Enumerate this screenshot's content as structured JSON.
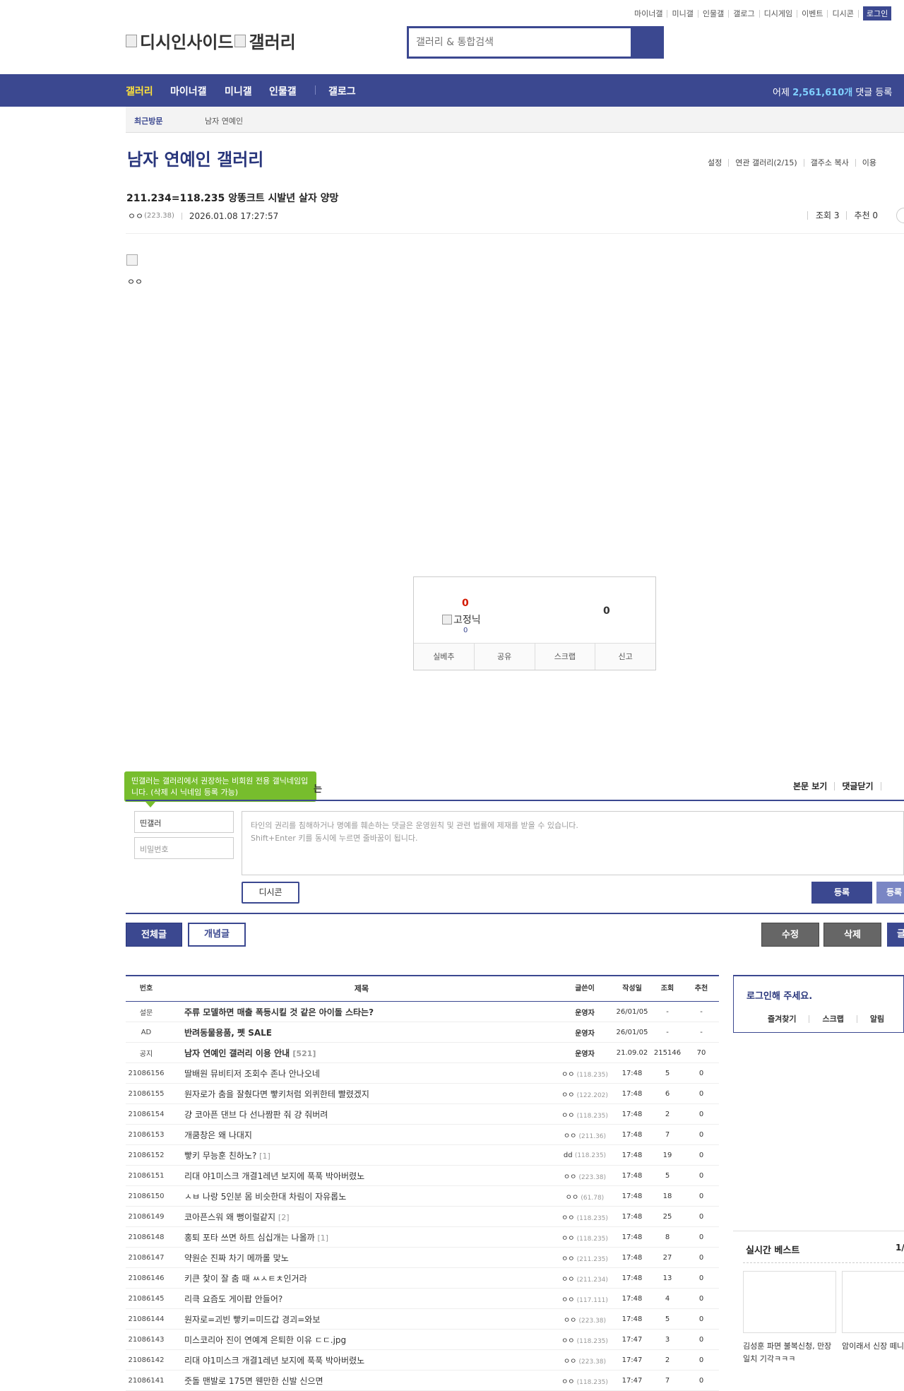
{
  "top_util": [
    "마이너갤",
    "미니갤",
    "인물갤",
    "갤로그",
    "디시게임",
    "이벤트",
    "디시콘"
  ],
  "login_btn": "로그인",
  "logo": {
    "left": "디시인사이드",
    "right": "갤러리"
  },
  "search": {
    "placeholder": "갤러리 & 통합검색"
  },
  "gnb": {
    "items": [
      "갤러리",
      "마이너갤",
      "미니갤",
      "인물갤",
      "갤로그"
    ],
    "stat_prefix": "어제 ",
    "stat_value": "2,561,610개",
    "stat_suffix": " 댓글 등록"
  },
  "visit": {
    "label": "최근방문",
    "gallery": "남자 연예인"
  },
  "gallery": {
    "title": "남자 연예인 갤러리",
    "menu": [
      "설정",
      "연관 갤러리(2/15)",
      "갤주소 복사",
      "이용"
    ]
  },
  "post": {
    "title": "211.234=118.235 앙똥크트 시발년 살자 양망",
    "writer": "ㅇㅇ",
    "ip": "(223.38)",
    "date": "2026.01.08 17:27:57",
    "views": "조회 3",
    "recommends": "추천 0",
    "body": "ㅇㅇ"
  },
  "recommend": {
    "up": "0",
    "fixnick": "고정닉",
    "fixnick_count": "0",
    "down": "0",
    "buttons": [
      "실베추",
      "공유",
      "스크랩",
      "신고"
    ]
  },
  "comment": {
    "tip": "띤갤러는 갤러리에서 권장하는 비회원 전용 갤닉네임입니다. (삭제 시 닉네임 등록 가능)",
    "tip_tail": "는",
    "right": [
      "본문 보기",
      "댓글닫기"
    ],
    "nick": "띤갤러",
    "pw": "비밀번호",
    "notice1": "타인의 권리를 침해하거나 명예를 훼손하는 댓글은 운영원칙 및 관련 법률에 제재를 받을 수 있습니다.",
    "notice2": "Shift+Enter 키를 동시에 누르면 줄바꿈이 됩니다.",
    "dccon": "디시콘",
    "register": "등록",
    "register2": "등록"
  },
  "buttons": {
    "all": "전체글",
    "concept": "개념글",
    "edit": "수정",
    "delete": "삭제",
    "write": "글"
  },
  "list": {
    "headers": [
      "번호",
      "제목",
      "글쓴이",
      "작성일",
      "조회",
      "추천"
    ],
    "rows": [
      {
        "no": "설문",
        "title": "주류 모델하면 매출 폭등시킬 것 같은 아이돌 스타는?",
        "reply": "",
        "writer": "운영자",
        "ip": "",
        "date": "26/01/05",
        "views": "-",
        "rec": "-",
        "bold": true
      },
      {
        "no": "AD",
        "title": "반려동물용품, 펫 SALE",
        "reply": "",
        "writer": "운영자",
        "ip": "",
        "date": "26/01/05",
        "views": "-",
        "rec": "-",
        "bold": true
      },
      {
        "no": "공지",
        "title": "남자 연예인 갤러리 이용 안내",
        "reply": "[521]",
        "writer": "운영자",
        "ip": "",
        "date": "21.09.02",
        "views": "215146",
        "rec": "70",
        "bold": true
      },
      {
        "no": "21086156",
        "title": "딸배원 뮤비티저 조회수 존나 안나오네",
        "reply": "",
        "writer": "ㅇㅇ",
        "ip": "(118.235)",
        "date": "17:48",
        "views": "5",
        "rec": "0",
        "bold": false
      },
      {
        "no": "21086155",
        "title": "원자로가 춤을 잘췄다면 빻키처럼 외퀴한테 빨렸겠지",
        "reply": "",
        "writer": "ㅇㅇ",
        "ip": "(122.202)",
        "date": "17:48",
        "views": "6",
        "rec": "0",
        "bold": false
      },
      {
        "no": "21086154",
        "title": "걍 코아픈 댄브 다 선나짬판 줘 걍 줘버려",
        "reply": "",
        "writer": "ㅇㅇ",
        "ip": "(118.235)",
        "date": "17:48",
        "views": "2",
        "rec": "0",
        "bold": false
      },
      {
        "no": "21086153",
        "title": "개쿰창은 왜 나대지",
        "reply": "",
        "writer": "ㅇㅇ",
        "ip": "(211.36)",
        "date": "17:48",
        "views": "7",
        "rec": "0",
        "bold": false
      },
      {
        "no": "21086152",
        "title": "빻키 무능훈 친하노?",
        "reply": "[1]",
        "writer": "dd",
        "ip": "(118.235)",
        "date": "17:48",
        "views": "19",
        "rec": "0",
        "bold": false
      },
      {
        "no": "21086151",
        "title": "리대 야1미스크 개결1레년 보지에 푹푹 박아버렸노",
        "reply": "",
        "writer": "ㅇㅇ",
        "ip": "(223.38)",
        "date": "17:48",
        "views": "5",
        "rec": "0",
        "bold": false
      },
      {
        "no": "21086150",
        "title": "ㅅㅂ 나랑 5인분 몸 비슷한대 차림이 자유롭노",
        "reply": "",
        "writer": "ㅇㅇ",
        "ip": "(61.78)",
        "date": "17:48",
        "views": "18",
        "rec": "0",
        "bold": false
      },
      {
        "no": "21086149",
        "title": "코아픈스워 왜 뻥이럴같지",
        "reply": "[2]",
        "writer": "ㅇㅇ",
        "ip": "(118.235)",
        "date": "17:48",
        "views": "25",
        "rec": "0",
        "bold": false
      },
      {
        "no": "21086148",
        "title": "홍퇴 포타 쓰면 하트 심십개는 나올까",
        "reply": "[1]",
        "writer": "ㅇㅇ",
        "ip": "(118.235)",
        "date": "17:48",
        "views": "8",
        "rec": "0",
        "bold": false
      },
      {
        "no": "21086147",
        "title": "약원순 진짜 차기 메까롤 맞노",
        "reply": "",
        "writer": "ㅇㅇ",
        "ip": "(211.235)",
        "date": "17:48",
        "views": "27",
        "rec": "0",
        "bold": false
      },
      {
        "no": "21086146",
        "title": "키큰 찿이 잘 춤 때 ㅆㅅㅌㅊ인거라",
        "reply": "",
        "writer": "ㅇㅇ",
        "ip": "(211.234)",
        "date": "17:48",
        "views": "13",
        "rec": "0",
        "bold": false
      },
      {
        "no": "21086145",
        "title": "리큭 요즘도 게이팝 안들어?",
        "reply": "",
        "writer": "ㅇㅇ",
        "ip": "(117.111)",
        "date": "17:48",
        "views": "4",
        "rec": "0",
        "bold": false
      },
      {
        "no": "21086144",
        "title": "원자로=괴빈 빻키=미드갑 경괴=와보",
        "reply": "",
        "writer": "ㅇㅇ",
        "ip": "(223.38)",
        "date": "17:48",
        "views": "5",
        "rec": "0",
        "bold": false
      },
      {
        "no": "21086143",
        "title": "미스코리아 진이 연예계 은퇴한 이유 ㄷㄷ.jpg",
        "reply": "",
        "writer": "ㅇㅇ",
        "ip": "(118.235)",
        "date": "17:47",
        "views": "3",
        "rec": "0",
        "bold": false
      },
      {
        "no": "21086142",
        "title": "리대 야1미스크 개결1레년 보지에 푹푹 박아버렸노",
        "reply": "",
        "writer": "ㅇㅇ",
        "ip": "(223.38)",
        "date": "17:47",
        "views": "2",
        "rec": "0",
        "bold": false
      },
      {
        "no": "21086141",
        "title": "줏돌 맨발로 175면 웬만한 신발 신으면",
        "reply": "",
        "writer": "ㅇㅇ",
        "ip": "(118.235)",
        "date": "17:47",
        "views": "7",
        "rec": "0",
        "bold": false
      }
    ]
  },
  "side": {
    "login_title": "로그인해 주세요.",
    "tabs": [
      "즐겨찾기",
      "스크랩",
      "알림"
    ],
    "best_title": "실시간 베스트",
    "best_page": "1/",
    "best_items": [
      {
        "caption": "김성훈 파면 불복신청, 만장일치 기각ㅋㅋㅋ"
      },
      {
        "caption": "암이래서 신장 떼니었다"
      }
    ]
  },
  "colors": {
    "brand": "#3b4890",
    "highlight": "#ffe23a",
    "tip": "#77bd2d"
  }
}
